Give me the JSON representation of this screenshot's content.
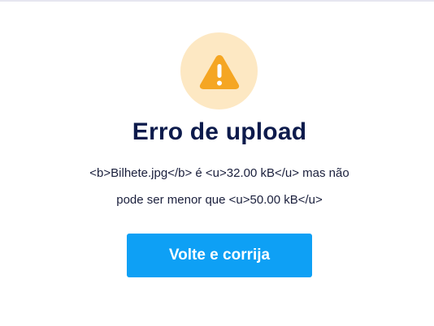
{
  "colors": {
    "warning_circle_bg": "#fde8c3",
    "warning_icon": "#f5a623",
    "title": "#0d1b4c",
    "button_bg": "#0ea0f5",
    "button_text": "#ffffff"
  },
  "dialog": {
    "icon": "warning-icon",
    "title": "Erro de upload",
    "message_line1": "<b>Bilhete.jpg</b> é <u>32.00 kB</u> mas não",
    "message_line2": "pode ser menor que <u>50.00 kB</u>",
    "button_label": "Volte e corrija"
  }
}
